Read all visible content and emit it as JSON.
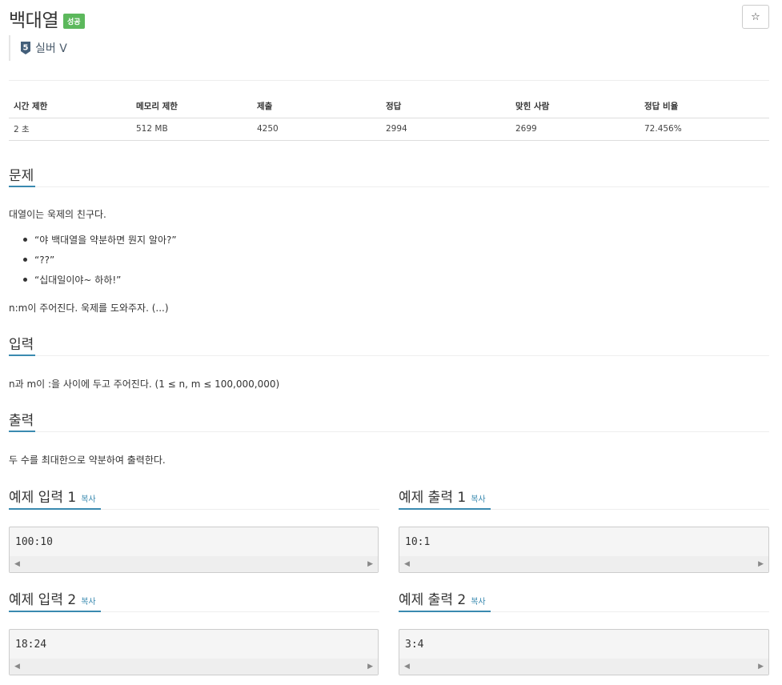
{
  "problem": {
    "title": "백대열",
    "status_badge": "성공",
    "star_icon": "☆",
    "tier_number": "5",
    "tier_label": "실버 V"
  },
  "info_table": {
    "headers": [
      "시간 제한",
      "메모리 제한",
      "제출",
      "정답",
      "맞힌 사람",
      "정답 비율"
    ],
    "values": [
      "2 초",
      "512 MB",
      "4250",
      "2994",
      "2699",
      "72.456%"
    ]
  },
  "sections": {
    "problem_heading": "문제",
    "problem_intro": "대열이는 욱제의 친구다.",
    "bullets": [
      "“야 백대열을 약분하면 뭔지 알아?”",
      "“??”",
      "“십대일이야~ 하하!”"
    ],
    "problem_outro": "n:m이 주어진다. 욱제를 도와주자. (...)",
    "input_heading": "입력",
    "input_text": "n과 m이 :을 사이에 두고 주어진다. (1 ≤ n, m ≤ 100,000,000)",
    "output_heading": "출력",
    "output_text": "두 수를 최대한으로 약분하여 출력한다."
  },
  "samples": {
    "copy_label": "복사",
    "in1_title": "예제 입력 1",
    "in1_value": "100:10",
    "out1_title": "예제 출력 1",
    "out1_value": "10:1",
    "in2_title": "예제 입력 2",
    "in2_value": "18:24",
    "out2_title": "예제 출력 2",
    "out2_value": "3:4"
  },
  "colors": {
    "success_badge": "#5cb85c",
    "accent": "#3a8ab0",
    "tier_silver": "#435f7a"
  }
}
